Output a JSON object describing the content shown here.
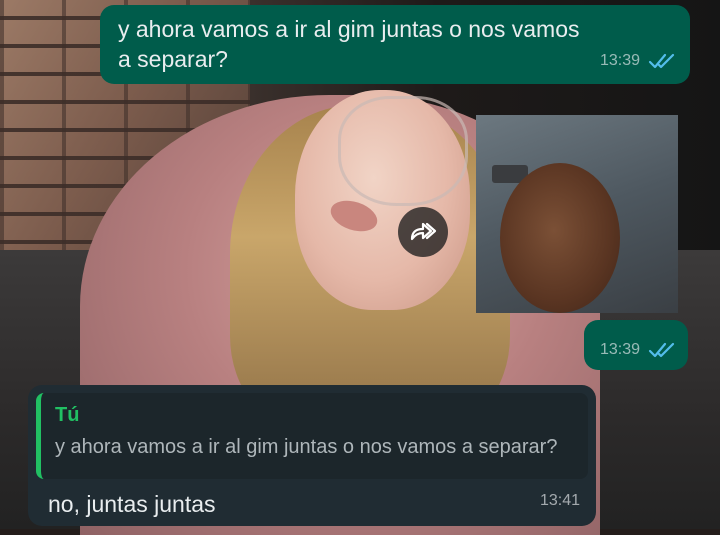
{
  "messages": [
    {
      "direction": "outgoing",
      "text": "y ahora vamos a ir al gim juntas o nos vamos a separar?",
      "time": "13:39",
      "status": "read"
    },
    {
      "direction": "outgoing",
      "type": "image",
      "time": "13:39",
      "status": "read"
    },
    {
      "direction": "incoming",
      "quoted": {
        "author": "Tú",
        "text": "y ahora vamos a ir al gim juntas o nos vamos a separar?"
      },
      "text": "no, juntas juntas",
      "time": "13:41"
    }
  ],
  "colors": {
    "outgoing_bubble": "#005c4b",
    "incoming_bubble": "#202c33",
    "quote_accent": "#21c063",
    "read_ticks": "#53bdeb"
  },
  "icons": {
    "forward": "forward-icon",
    "read_receipt": "double-check-icon"
  }
}
